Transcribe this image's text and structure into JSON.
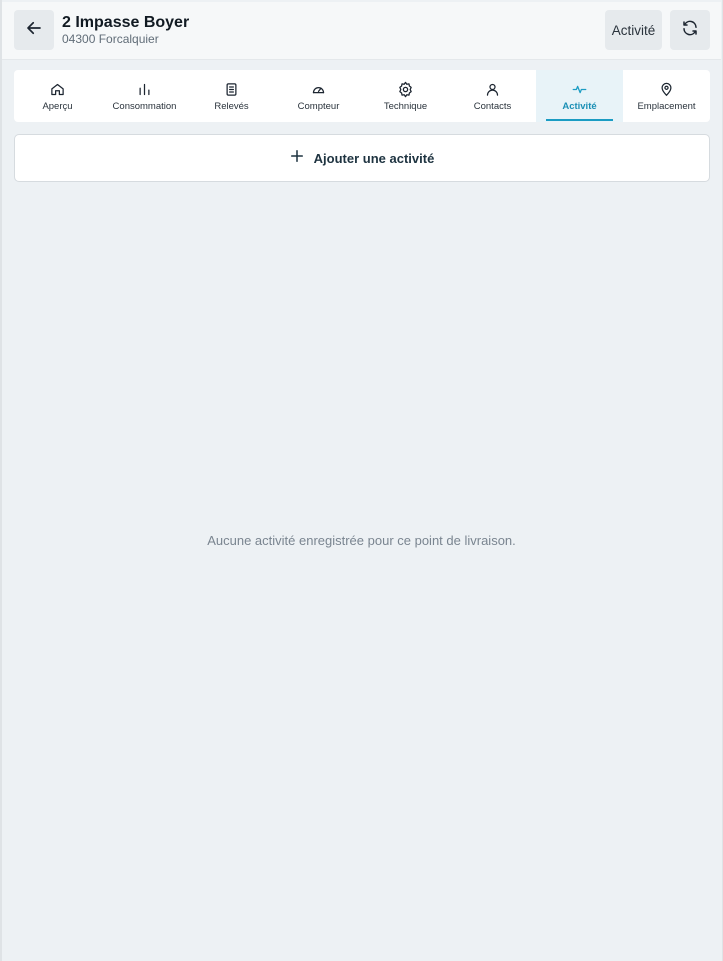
{
  "header": {
    "title": "2 Impasse Boyer",
    "subtitle": "04300 Forcalquier",
    "activity_button": "Activité",
    "back_icon": "arrow-left-icon",
    "refresh_icon": "refresh-icon"
  },
  "tabs": [
    {
      "label": "Aperçu",
      "icon": "home-icon",
      "active": false
    },
    {
      "label": "Consommation",
      "icon": "bar-chart-icon",
      "active": false
    },
    {
      "label": "Relevés",
      "icon": "clipboard-icon",
      "active": false
    },
    {
      "label": "Compteur",
      "icon": "gauge-icon",
      "active": false
    },
    {
      "label": "Technique",
      "icon": "gear-icon",
      "active": false
    },
    {
      "label": "Contacts",
      "icon": "user-icon",
      "active": false
    },
    {
      "label": "Activité",
      "icon": "activity-pulse-icon",
      "active": true
    },
    {
      "label": "Emplacement",
      "icon": "map-pin-icon",
      "active": false
    }
  ],
  "main": {
    "add_activity_label": "Ajouter une activité",
    "empty_message": "Aucune activité enregistrée pour ce point de livraison."
  },
  "colors": {
    "accent": "#1b9cc3",
    "background": "#edf1f4"
  }
}
